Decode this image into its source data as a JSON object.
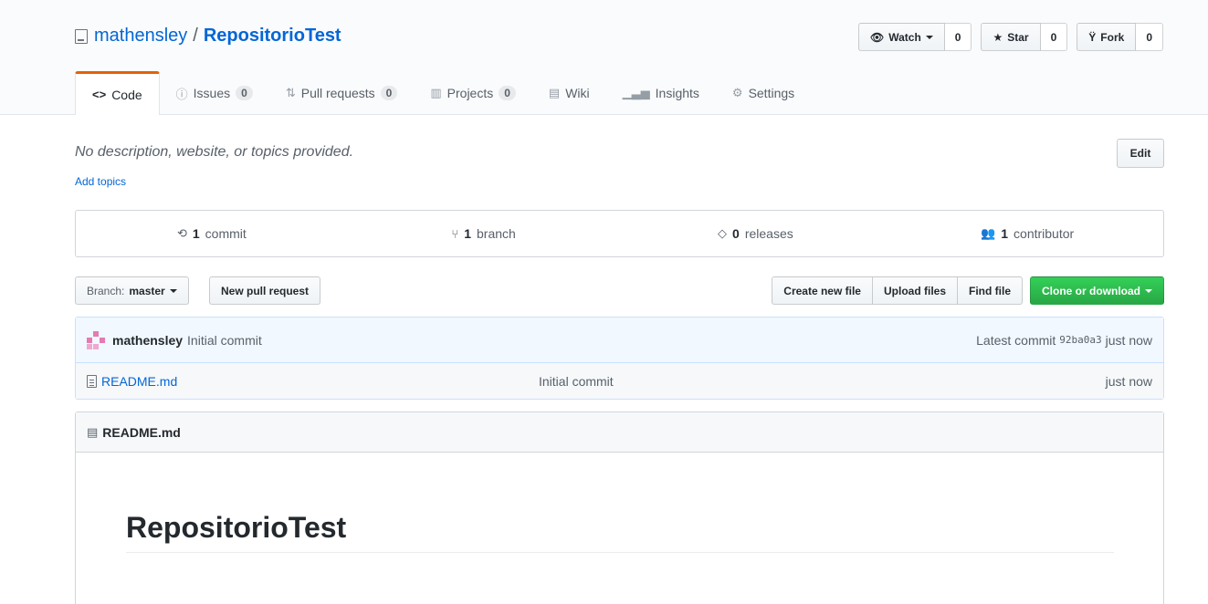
{
  "repo": {
    "owner": "mathensley",
    "separator": "/",
    "name": "RepositorioTest"
  },
  "actions": {
    "watch": {
      "label": "Watch",
      "count": "0"
    },
    "star": {
      "label": "Star",
      "count": "0"
    },
    "fork": {
      "label": "Fork",
      "count": "0"
    }
  },
  "tabs": [
    {
      "icon": "<>",
      "label": "Code",
      "count": ""
    },
    {
      "icon": "ⓘ",
      "label": "Issues",
      "count": "0"
    },
    {
      "icon": "⇅",
      "label": "Pull requests",
      "count": "0"
    },
    {
      "icon": "▥",
      "label": "Projects",
      "count": "0"
    },
    {
      "icon": "▤",
      "label": "Wiki",
      "count": ""
    },
    {
      "icon": "▁▃▅",
      "label": "Insights",
      "count": ""
    },
    {
      "icon": "⚙",
      "label": "Settings",
      "count": ""
    }
  ],
  "description": "No description, website, or topics provided.",
  "add_topics": "Add topics",
  "edit_label": "Edit",
  "summary": {
    "commits": {
      "num": "1",
      "label": "commit"
    },
    "branches": {
      "num": "1",
      "label": "branch"
    },
    "releases": {
      "num": "0",
      "label": "releases"
    },
    "contributors": {
      "num": "1",
      "label": "contributor"
    }
  },
  "filenav": {
    "branch_prefix": "Branch:",
    "branch": "master",
    "new_pr": "New pull request",
    "create_file": "Create new file",
    "upload": "Upload files",
    "find": "Find file",
    "clone": "Clone or download"
  },
  "commit": {
    "author": "mathensley",
    "message": "Initial commit",
    "latest_label": "Latest commit",
    "sha": "92ba0a3",
    "age": "just now"
  },
  "files": [
    {
      "name": "README.md",
      "message": "Initial commit",
      "age": "just now"
    }
  ],
  "readme": {
    "header": "README.md",
    "title": "RepositorioTest"
  },
  "colors": {
    "link": "#0366d6",
    "tab_accent": "#e36209",
    "clone_green": "#28a745"
  }
}
